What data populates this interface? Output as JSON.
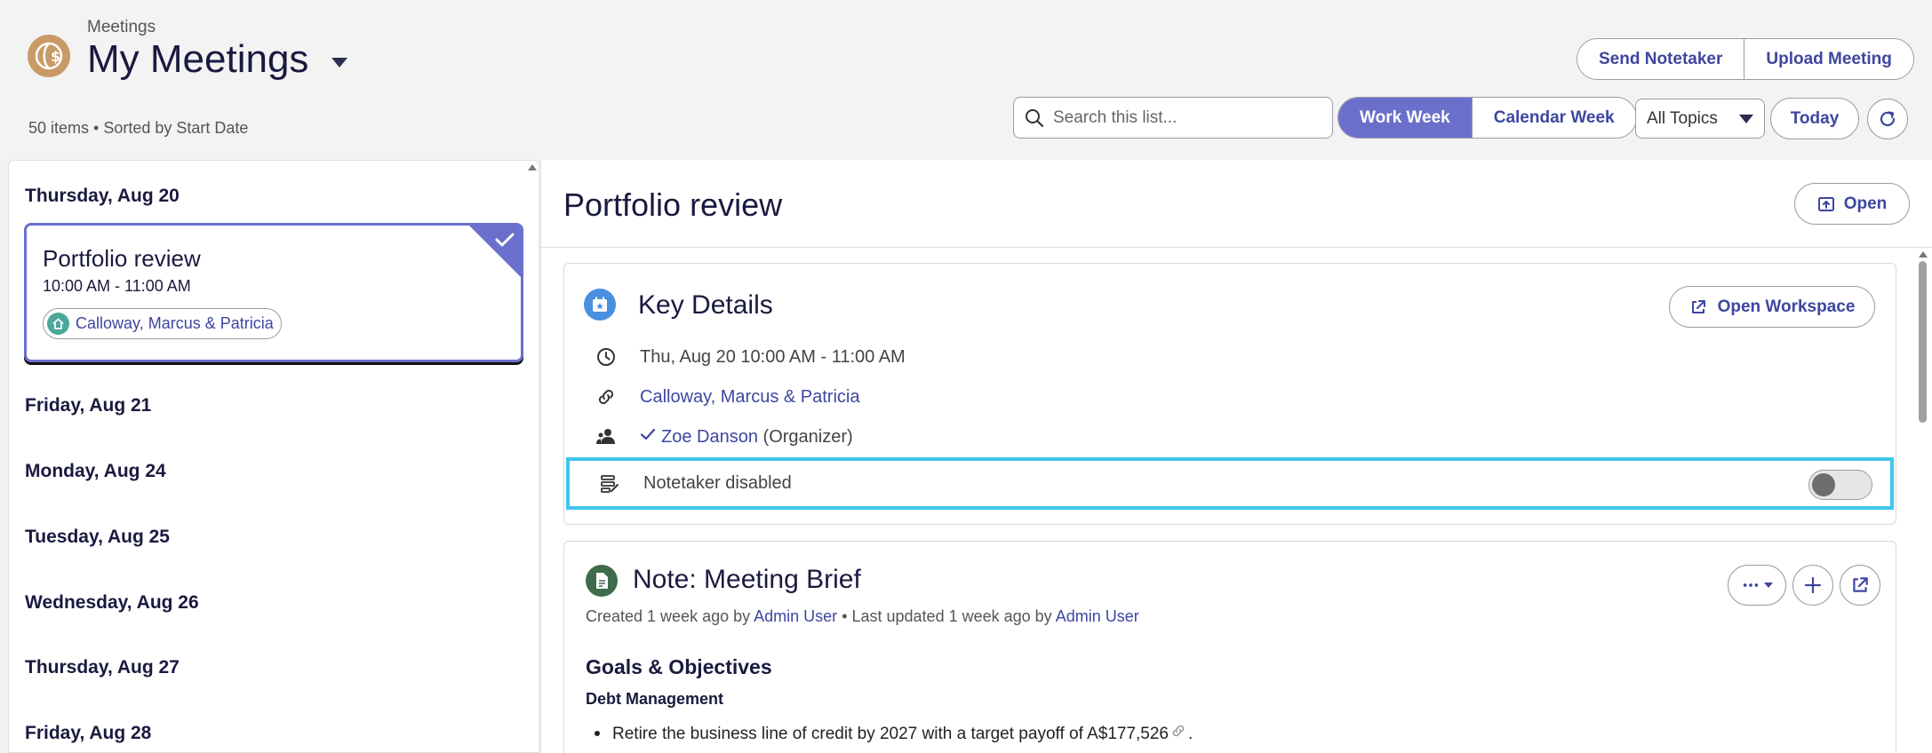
{
  "header": {
    "breadcrumb": "Meetings",
    "title": "My Meetings",
    "list_meta": "50 items • Sorted by Start Date",
    "logo_icon": "globe-dollar-icon"
  },
  "top_actions": {
    "send_notetaker": "Send Notetaker",
    "upload_meeting": "Upload Meeting"
  },
  "toolbar": {
    "search_placeholder": "Search this list...",
    "work_week": "Work Week",
    "calendar_week": "Calendar Week",
    "active_view": "Work Week",
    "topics_selected": "All Topics",
    "today": "Today"
  },
  "meeting_list": {
    "days": [
      {
        "label": "Thursday, Aug 20"
      },
      {
        "label": "Friday, Aug 21"
      },
      {
        "label": "Monday, Aug 24"
      },
      {
        "label": "Tuesday, Aug 25"
      },
      {
        "label": "Wednesday, Aug 26"
      },
      {
        "label": "Thursday, Aug 27"
      },
      {
        "label": "Friday, Aug 28"
      }
    ],
    "selected_meeting": {
      "title": "Portfolio review",
      "time": "10:00 AM - 11:00 AM",
      "household": "Calloway, Marcus & Patricia"
    }
  },
  "detail": {
    "title": "Portfolio review",
    "open_label": "Open",
    "key_details": {
      "title": "Key Details",
      "workspace_label": "Open Workspace",
      "datetime": "Thu, Aug 20 10:00 AM - 11:00 AM",
      "household": "Calloway, Marcus & Patricia",
      "organizer_name": "Zoe Danson",
      "organizer_role": "(Organizer)",
      "notetaker_status": "Notetaker disabled",
      "notetaker_enabled": false
    },
    "note": {
      "title": "Note: Meeting Brief",
      "meta_created_prefix": "Created 1 week ago by",
      "meta_created_by": "Admin User",
      "meta_updated_prefix": "• Last updated 1 week ago by",
      "meta_updated_by": "Admin User",
      "heading": "Goals & Objectives",
      "subheading": "Debt Management",
      "bullet_1_text": "Retire the business line of credit by 2027 with a target payoff of A$177,526",
      "bullet_1_tail": "."
    }
  },
  "colors": {
    "accent": "#6b6fcc",
    "link": "#3d46a0",
    "highlight": "#3ec6ee",
    "logo": "#c89a66",
    "note_icon": "#3f6b4a",
    "calendar_icon": "#4a8fe0"
  }
}
